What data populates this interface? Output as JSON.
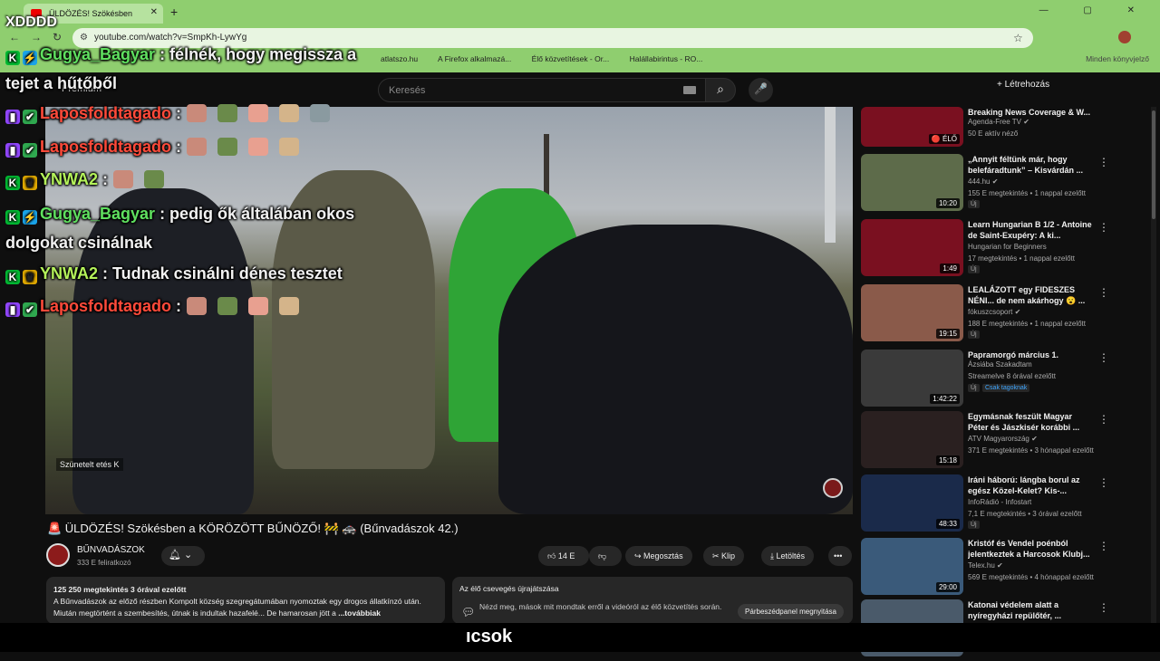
{
  "browser": {
    "tab_title": "ÜLDÖZÉS! Szökésben",
    "new_tab": "+",
    "window_controls": "— ▢ ✕",
    "url": "youtube.com/watch?v=SmpKh-LywYg",
    "bookmarks": [
      "atlatszo.hu",
      "A Firefox alkalmazá...",
      "Élő közvetítések - Or...",
      "Halállabirintus - RO..."
    ],
    "bookmarks_right": "Minden könyvjelző"
  },
  "overlay": {
    "xd": "XDDDD",
    "chat": [
      {
        "user": "Gugya_Bagyar",
        "user_color": "#5fe05f",
        "badges": [
          "k",
          "w"
        ],
        "text": ": félnék, hogy megissza a",
        "cont": "tejet a hűtőből"
      },
      {
        "user": "Laposfoldtagado",
        "user_color": "#ff4a3a",
        "badges": [
          "t",
          "g"
        ],
        "text": ":",
        "emotes": 5
      },
      {
        "user": "Laposfoldtagado",
        "user_color": "#ff4a3a",
        "badges": [
          "t",
          "g"
        ],
        "text": ":",
        "emotes": 4
      },
      {
        "user": "YNWA2",
        "user_color": "#b4f25a",
        "badges": [
          "k",
          "c"
        ],
        "text": ":",
        "emotes": 2
      },
      {
        "user": "Gugya_Bagyar",
        "user_color": "#5fe05f",
        "badges": [
          "k",
          "w"
        ],
        "text": ": pedig ők általában okos",
        "cont": "dolgokat csinálnak"
      },
      {
        "user": "YNWA2",
        "user_color": "#b4f25a",
        "badges": [
          "k",
          "c"
        ],
        "text": ": Tudnak csinálni dénes tesztet"
      },
      {
        "user": "Laposfoldtagado",
        "user_color": "#ff4a3a",
        "badges": [
          "t",
          "g"
        ],
        "text": ":",
        "emotes": 4
      }
    ]
  },
  "header": {
    "premium": "Prémium",
    "search_placeholder": "Keresés",
    "create": "+ Létrehozás"
  },
  "video": {
    "caption": "Szünetelt etés  K",
    "title": "🚨 ÜLDÖZÉS! Szökésben a KÖRÖZÖTT BŰNÖZŐ! 🚧 🚓 (Bűnvadászok 42.)",
    "channel": "BŰNVADÁSZOK",
    "subscribers": "333 E feliratkozó",
    "likes": "14 E",
    "share": "Megosztás",
    "clip": "Klip",
    "download": "Letöltés",
    "more": "•••",
    "views": "125 250 megtekintés  3 órával ezelőtt",
    "description": "A Bűnvadászok az előző részben Kompolt község szegregátumában nyomoztak egy drogos állatkínzó után. Miután megtörtént a szembesítés, útnak is indultak hazafelé... De hamarosan jött a",
    "more_link": "...továbbiak",
    "replay_title": "Az élő csevegés újrajátszása",
    "replay_text": "Nézd meg, mások mit mondtak erről a videóról az élő közvetítés során.",
    "replay_open": "Párbeszédpanel megnyitása",
    "subtitle": "ıcsok"
  },
  "sidebar": [
    {
      "title": "Breaking News Coverage & W...",
      "channel": "Agenda-Free TV ✔",
      "meta": "50 E aktív néző",
      "duration": "🔴 ÉLŐ",
      "color": "#7a1020"
    },
    {
      "title": "„Annyit féltünk már, hogy belefáradtunk” – Kisvárdán ...",
      "channel": "444.hu ✔",
      "meta": "155 E megtekintés • 1 nappal ezelőtt",
      "duration": "10:20",
      "badge": "Új",
      "color": "#5d6b4a"
    },
    {
      "title": "Learn Hungarian B 1/2 - Antoine de Saint-Exupéry: A ki...",
      "channel": "Hungarian for Beginners",
      "meta": "17 megtekintés • 1 nappal ezelőtt",
      "duration": "1:49",
      "badge": "Új",
      "color": "#7a1020"
    },
    {
      "title": "LEALÁZOTT egy FIDESZES NÉNI... de nem akárhogy 😮 ...",
      "channel": "fókuszcsoport ✔",
      "meta": "188 E megtekintés • 1 nappal ezelőtt",
      "duration": "19:15",
      "badge": "Új",
      "color": "#8a5a4a"
    },
    {
      "title": "Papramorgó március 1.",
      "channel": "Ázsiába Szakadtam",
      "meta": "Streamelve 8 órával ezelőtt",
      "duration": "1:42:22",
      "badge": "Új",
      "badge2": "Csak tagoknak",
      "color": "#3a3a3a"
    },
    {
      "title": "Egymásnak feszült Magyar Péter és Jászkisér korábbi ...",
      "channel": "ATV Magyarország ✔",
      "meta": "371 E megtekintés • 3 hónappal ezelőtt",
      "duration": "15:18",
      "color": "#2a2020"
    },
    {
      "title": "Iráni háború: lángba borul az egész Közel-Kelet? Kis-...",
      "channel": "InfoRádió - Infostart",
      "meta": "7,1 E megtekintés • 3 órával ezelőtt",
      "duration": "48:33",
      "badge": "Új",
      "color": "#1a2a4a"
    },
    {
      "title": "Kristóf és Vendel poénból jelentkeztek a Harcosok Klubj...",
      "channel": "Telex.hu ✔",
      "meta": "569 E megtekintés • 4 hónappal ezelőtt",
      "duration": "29:00",
      "color": "#3a5a7a"
    },
    {
      "title": "Katonai védelem alatt a nyíregyházi repülőtér, ...",
      "channel": "",
      "meta": "",
      "duration": "",
      "color": "#4a5a6a"
    }
  ]
}
